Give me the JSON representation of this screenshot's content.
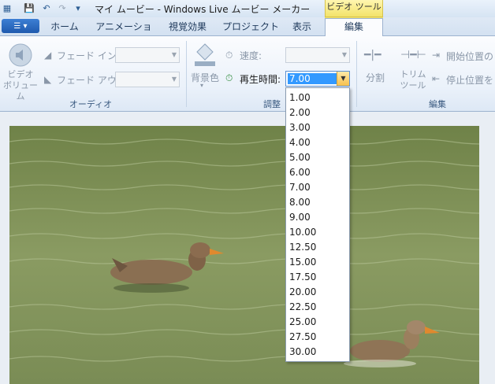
{
  "window": {
    "title": "マイ ムービー - Windows Live ムービー メーカー",
    "context_tab_title": "ビデオ ツール"
  },
  "tabs": [
    "ホーム",
    "アニメーション",
    "視覚効果",
    "プロジェクト",
    "表示",
    "編集"
  ],
  "active_tab": "編集",
  "audio_group": {
    "label": "オーディオ",
    "video_volume": "ビデオ\nボリューム",
    "fade_in": "フェード イン:",
    "fade_out": "フェード アウト:"
  },
  "adjust_group": {
    "label": "調整",
    "background_color": "背景色",
    "speed": "速度:",
    "duration": "再生時間:",
    "duration_value": "7.00"
  },
  "edit_group": {
    "label": "編集",
    "split": "分割",
    "trim_tool": "トリム\nツール",
    "set_start": "開始位置の",
    "set_end": "停止位置を"
  },
  "duration_options": [
    "1.00",
    "2.00",
    "3.00",
    "4.00",
    "5.00",
    "6.00",
    "7.00",
    "8.00",
    "9.00",
    "10.00",
    "12.50",
    "15.00",
    "17.50",
    "20.00",
    "22.50",
    "25.00",
    "27.50",
    "30.00"
  ],
  "colors": {
    "accent": "#3399ff",
    "context_tab": "#f3e36a",
    "water": "#7d8f57"
  }
}
